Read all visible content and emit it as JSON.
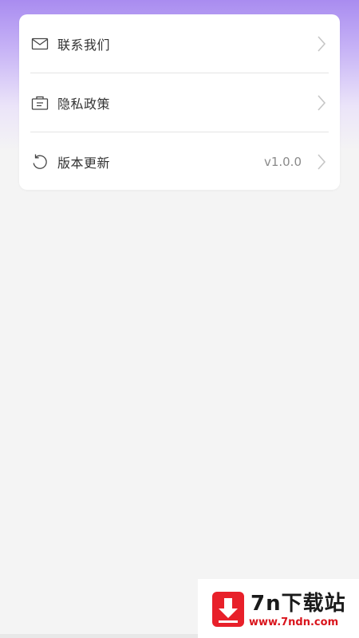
{
  "settings_menu": {
    "items": [
      {
        "label": "联系我们",
        "icon": "mail-icon",
        "value": ""
      },
      {
        "label": "隐私政策",
        "icon": "policy-icon",
        "value": ""
      },
      {
        "label": "版本更新",
        "icon": "refresh-icon",
        "value": "v1.0.0"
      }
    ]
  },
  "watermark": {
    "title": "7n下载站",
    "url": "www.7ndn.com",
    "icon": "download-arrow-icon",
    "brand_color": "#e8202a"
  },
  "colors": {
    "header_gradient_top": "#a98cf0",
    "background": "#f4f4f4",
    "card": "#ffffff"
  }
}
